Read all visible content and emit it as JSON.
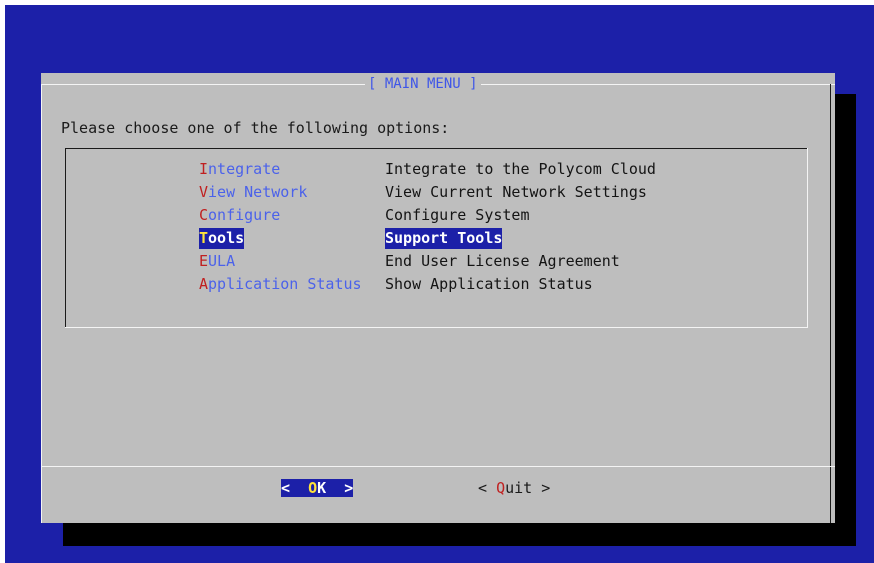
{
  "dialog": {
    "title": "[ MAIN MENU ]",
    "prompt": "Please choose one of the following options:"
  },
  "menu": {
    "items": [
      {
        "hotkey": "I",
        "rest": "ntegrate",
        "description": "Integrate to the Polycom Cloud",
        "selected": false
      },
      {
        "hotkey": "V",
        "rest": "iew Network",
        "description": "View Current Network Settings",
        "selected": false
      },
      {
        "hotkey": "C",
        "rest": "onfigure",
        "description": "Configure System",
        "selected": false
      },
      {
        "hotkey": "T",
        "rest": "ools",
        "description": "Support Tools",
        "selected": true
      },
      {
        "hotkey": "E",
        "rest": "ULA",
        "description": "End User License Agreement",
        "selected": false
      },
      {
        "hotkey": "A",
        "rest": "pplication Status",
        "description": "Show Application Status",
        "selected": false
      }
    ]
  },
  "buttons": {
    "ok": {
      "left": "<  ",
      "hotkey": "O",
      "rest": "K",
      "right": "  >"
    },
    "quit": {
      "left": "< ",
      "hotkey": "Q",
      "rest": "uit",
      "right": " >"
    }
  },
  "colors": {
    "background": "#1c20a8",
    "dialog": "#bebebe",
    "title": "#3f56e8",
    "hotkey": "#c02020",
    "selected_hotkey": "#ffe23a",
    "item_tag": "#4b62ea"
  }
}
